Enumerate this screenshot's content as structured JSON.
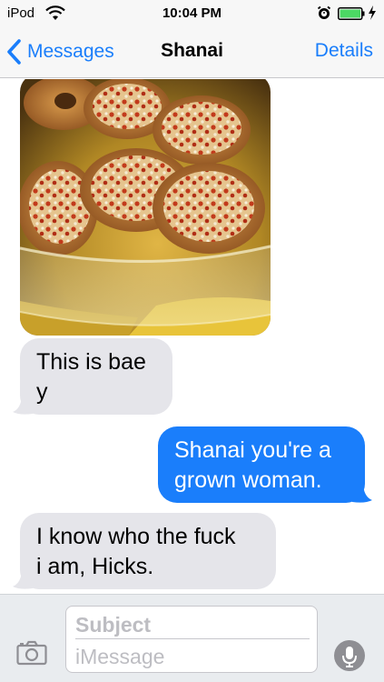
{
  "status_bar": {
    "device": "iPod",
    "time": "10:04 PM",
    "icons": [
      "wifi-icon",
      "alarm-icon",
      "battery-icon",
      "charging-bolt-icon"
    ]
  },
  "nav": {
    "back_label": "Messages",
    "title": "Shanai",
    "details_label": "Details"
  },
  "messages": [
    {
      "type": "image",
      "direction": "incoming",
      "content": "photo of mini pizza bagels in a glass dish"
    },
    {
      "type": "text",
      "direction": "incoming",
      "lines": [
        "This is bae",
        "y"
      ]
    },
    {
      "type": "text",
      "direction": "outgoing",
      "lines": [
        "Shanai you're a",
        "grown woman."
      ]
    },
    {
      "type": "text",
      "direction": "incoming",
      "lines": [
        "I know who the fuck",
        "i am, Hicks."
      ]
    }
  ],
  "composer": {
    "subject_placeholder": "Subject",
    "message_placeholder": "iMessage",
    "camera_icon": "camera-icon",
    "mic_icon": "microphone-icon"
  },
  "colors": {
    "accent": "#1a7efb",
    "incoming_bubble": "#e5e5ea",
    "outgoing_bubble": "#1a7efb",
    "bar_background": "#f7f7f7"
  }
}
